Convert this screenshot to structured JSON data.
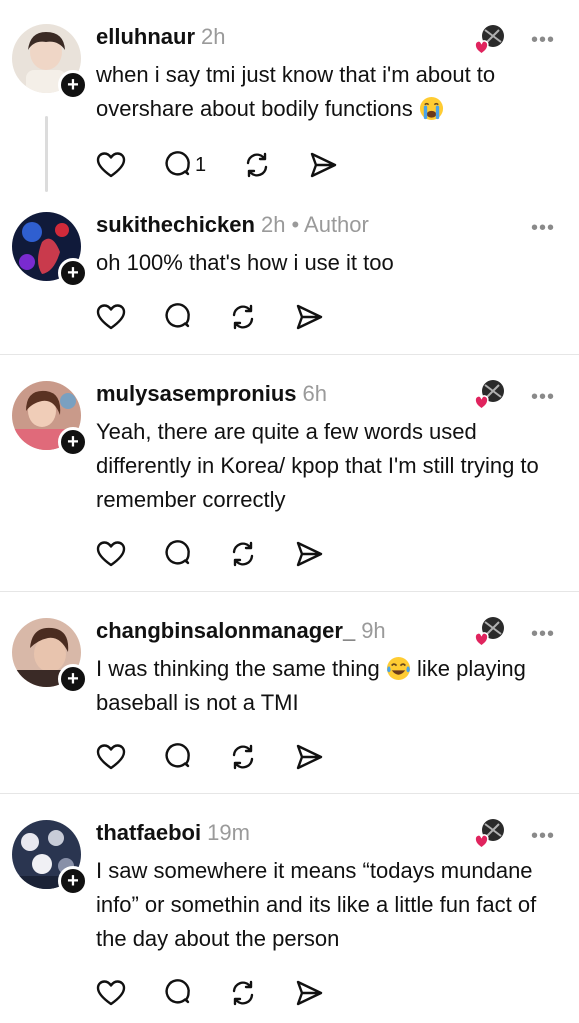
{
  "posts": [
    {
      "username": "elluhnaur",
      "time": "2h",
      "author_tag": "",
      "text": "when i say tmi just know that i'm about to overshare about bodily functions",
      "emoji": "crying-face-emoji",
      "reply_count": "1",
      "has_reaction": true
    },
    {
      "username": "sukithechicken",
      "time": "2h",
      "author_tag": "• Author",
      "text": "oh 100% that's how i use it too",
      "reply_count": "",
      "has_reaction": false
    },
    {
      "username": "mulysasempronius",
      "time": "6h",
      "author_tag": "",
      "text": "Yeah, there are quite a few words used differently in Korea/ kpop that I'm still trying to remember correctly",
      "reply_count": "",
      "has_reaction": true
    },
    {
      "username": "changbinsalonmanager_",
      "time": "9h",
      "author_tag": "",
      "text_before_emoji": "I was thinking the same thing",
      "text_after_emoji": " like playing baseball is not a TMI",
      "emoji": "tears-of-joy-emoji",
      "reply_count": "",
      "has_reaction": true
    },
    {
      "username": "thatfaeboi",
      "time": "19m",
      "author_tag": "",
      "text": "I saw somewhere it means “todays mundane info” or somethin and its like a little fun fact of the day about the person",
      "reply_count": "",
      "has_reaction": true
    }
  ],
  "icons": {
    "like": "heart-icon",
    "reply": "comment-icon",
    "repost": "repost-icon",
    "share": "send-icon",
    "menu": "more-icon",
    "follow": "plus-icon"
  },
  "menu_glyph": "•••",
  "follow_glyph": "+",
  "colors": {
    "text": "#111111",
    "muted": "#9a9a9a",
    "divider": "#e6e6e6",
    "heart": "#e0245e"
  }
}
